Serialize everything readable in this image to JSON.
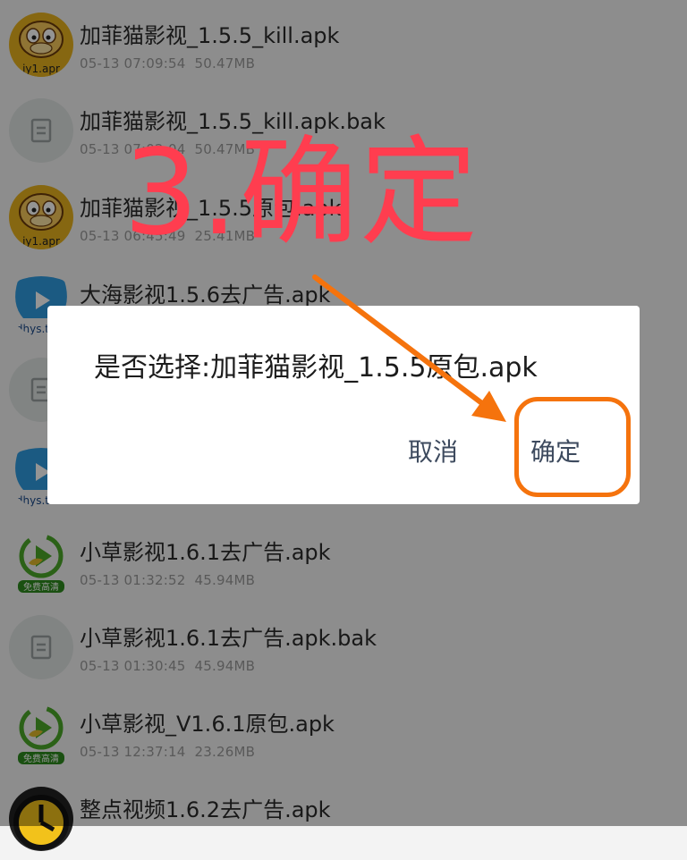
{
  "files": [
    {
      "icon": "garfield-app-icon",
      "name": "加菲猫影视_1.5.5_kill.apk",
      "date": "05-13 07:09:54",
      "size": "50.47MB"
    },
    {
      "icon": "file-icon",
      "name": "加菲猫影视_1.5.5_kill.apk.bak",
      "date": "05-13 07:02:04",
      "size": "50.47MB"
    },
    {
      "icon": "garfield-app-icon",
      "name": "加菲猫影视_1.5.5原包.apk",
      "date": "05-13 06:45:49",
      "size": "25.41MB"
    },
    {
      "icon": "dahai-app-icon",
      "name": "大海影视1.5.6去广告.apk",
      "date": "",
      "size": ""
    },
    {
      "icon": "file-icon",
      "name": "",
      "date": "",
      "size": ""
    },
    {
      "icon": "dahai-app-icon",
      "name": "",
      "date": "",
      "size": ""
    },
    {
      "icon": "xiaocao-app-icon",
      "name": "小草影视1.6.1去广告.apk",
      "date": "05-13 01:32:52",
      "size": "45.94MB"
    },
    {
      "icon": "file-icon",
      "name": "小草影视1.6.1去广告.apk.bak",
      "date": "05-13 01:30:45",
      "size": "45.94MB"
    },
    {
      "icon": "xiaocao-app-icon",
      "name": "小草影视_V1.6.1原包.apk",
      "date": "05-13 12:37:14",
      "size": "23.26MB"
    },
    {
      "icon": "zhengdian-app-icon",
      "name": "整点视频1.6.2去广告.apk",
      "date": "",
      "size": ""
    }
  ],
  "icon_labels": {
    "garfield": "iy1.apr",
    "dahai": "dhys.tv",
    "xiaocao": "免费高清"
  },
  "dialog": {
    "message": "是否选择:加菲猫影视_1.5.5原包.apk",
    "cancel_label": "取消",
    "confirm_label": "确定"
  },
  "annotation": {
    "text": "3.确定",
    "text_color": "#ff3d4f",
    "highlight_color": "#f5730d"
  }
}
